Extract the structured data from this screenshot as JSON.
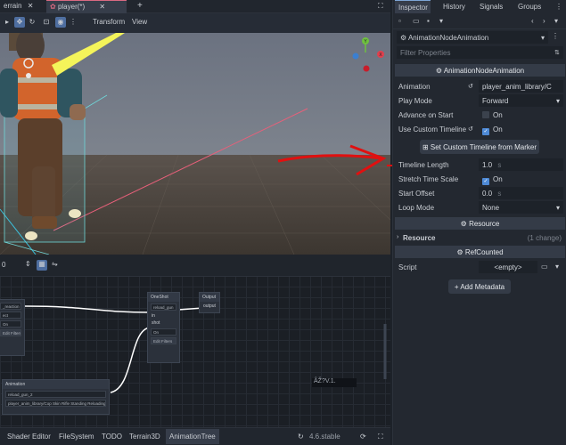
{
  "top_tabs": [
    {
      "label": "errain",
      "active": false
    },
    {
      "label": "player(*)",
      "active": true
    }
  ],
  "view_toolbar": {
    "transform_label": "Transform",
    "view_label": "View"
  },
  "gizmo_axes": {
    "y": "Y",
    "x": "X"
  },
  "anim_tree": {
    "left_node_label": "_reaction",
    "left_field1": "ect",
    "left_field2": "On",
    "left_edit_filters": "Edit Filters",
    "numeric_value": "0",
    "oneshot": {
      "title": "OneShot",
      "anim_field": "reload_gun",
      "in_label": "in",
      "shot_label": "shot",
      "mode": "On",
      "edit_filters": "Edit Filters"
    },
    "output_node": {
      "title": "Output",
      "port": "output"
    },
    "animation_node": {
      "title": "Animation",
      "anim_name": "reload_gun_2",
      "resource_path": "player_anim_library/Cop Skin Rifle Standing Reloading"
    },
    "watermark": "ÂŽ?V.1."
  },
  "bottom_bar": {
    "items": [
      "Shader Editor",
      "FileSystem",
      "TODO",
      "Terrain3D",
      "AnimationTree"
    ],
    "active_index": 4,
    "version": "4.6.stable"
  },
  "inspector": {
    "tabs": [
      "Inspector",
      "History",
      "Signals",
      "Groups"
    ],
    "node_type": "AnimationNodeAnimation",
    "filter_placeholder": "Filter Properties",
    "section_title": "AnimationNodeAnimation",
    "properties": [
      {
        "label": "Animation",
        "value": "player_anim_library/C"
      },
      {
        "label": "Play Mode",
        "value": "Forward"
      },
      {
        "label": "Advance on Start",
        "value": "On",
        "checked": false
      },
      {
        "label": "Use Custom Timeline",
        "value": "On",
        "checked": true
      }
    ],
    "set_timeline_button": "Set Custom Timeline from Marker",
    "timeline_props": [
      {
        "label": "Timeline Length",
        "value": "1.0",
        "unit": "s"
      },
      {
        "label": "Stretch Time Scale",
        "value": "On",
        "checked": true
      },
      {
        "label": "Start Offset",
        "value": "0.0",
        "unit": "s"
      },
      {
        "label": "Loop Mode",
        "value": "None"
      }
    ],
    "resource_section": "Resource",
    "resource_row": {
      "label": "Resource",
      "note": "(1 change)"
    },
    "refcounted_section": "RefCounted",
    "script_row": {
      "label": "Script",
      "value": "<empty>"
    },
    "add_metadata": "Add Metadata"
  },
  "colors": {
    "accent": "#4e8ad6",
    "annotation_red": "#e01010",
    "bone_yellow": "#f4f45a"
  }
}
